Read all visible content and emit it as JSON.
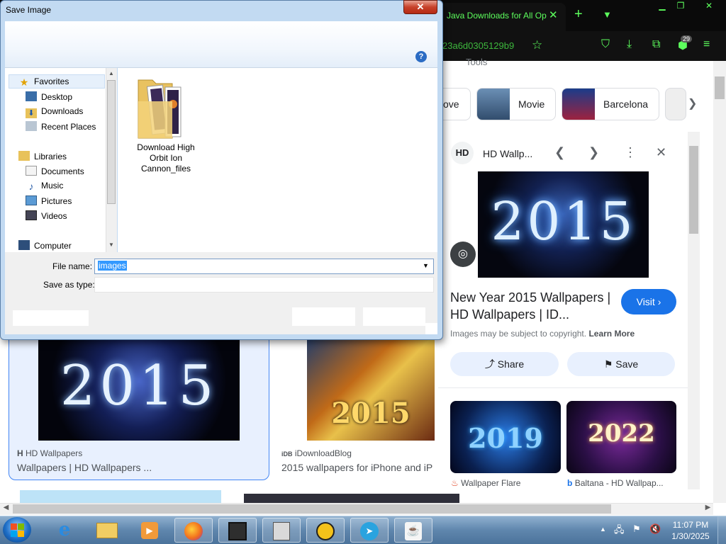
{
  "browser": {
    "active_tab_title": "Java Downloads for All Op",
    "url_fragment": "23a6d0305129b9",
    "extension_badge": "29"
  },
  "page": {
    "tools_label": "Tools",
    "chips": [
      {
        "label": "ove"
      },
      {
        "label": "Movie"
      },
      {
        "label": "Barcelona"
      }
    ],
    "results": [
      {
        "source": "HD Wallpapers",
        "title": "Wallpapers | HD Wallpapers ...",
        "image_text": "2015"
      },
      {
        "source": "iDownloadBlog",
        "title": "2015 wallpapers for iPhone and iP",
        "image_text": "2015"
      }
    ]
  },
  "side_panel": {
    "site_icon": "HD",
    "site_name": "HD Wallp...",
    "image_text": "2015",
    "title": "New Year 2015 Wallpapers | HD Wallpapers | ID...",
    "visit_label": "Visit",
    "copyright": "Images may be subject to copyright.",
    "learn_more": "Learn More",
    "share_label": "Share",
    "save_label": "Save",
    "related": [
      {
        "year": "2019",
        "source": "Wallpaper Flare"
      },
      {
        "year": "2022",
        "source": "Baltana - HD Wallpap..."
      }
    ]
  },
  "dialog": {
    "title": "Save Image",
    "nav": {
      "favorites": "Favorites",
      "desktop": "Desktop",
      "downloads": "Downloads",
      "recent": "Recent Places",
      "libraries": "Libraries",
      "documents": "Documents",
      "music": "Music",
      "pictures": "Pictures",
      "videos": "Videos",
      "computer": "Computer"
    },
    "folder_name": "Download High Orbit Ion Cannon_files",
    "file_name_label": "File name:",
    "file_name_value": "images",
    "save_type_label": "Save as type:"
  },
  "taskbar": {
    "time": "11:07 PM",
    "date": "1/30/2025"
  },
  "colors": {
    "accent_green": "#5dff5d",
    "google_blue": "#1a73e8",
    "selection_blue": "#3399ff"
  }
}
